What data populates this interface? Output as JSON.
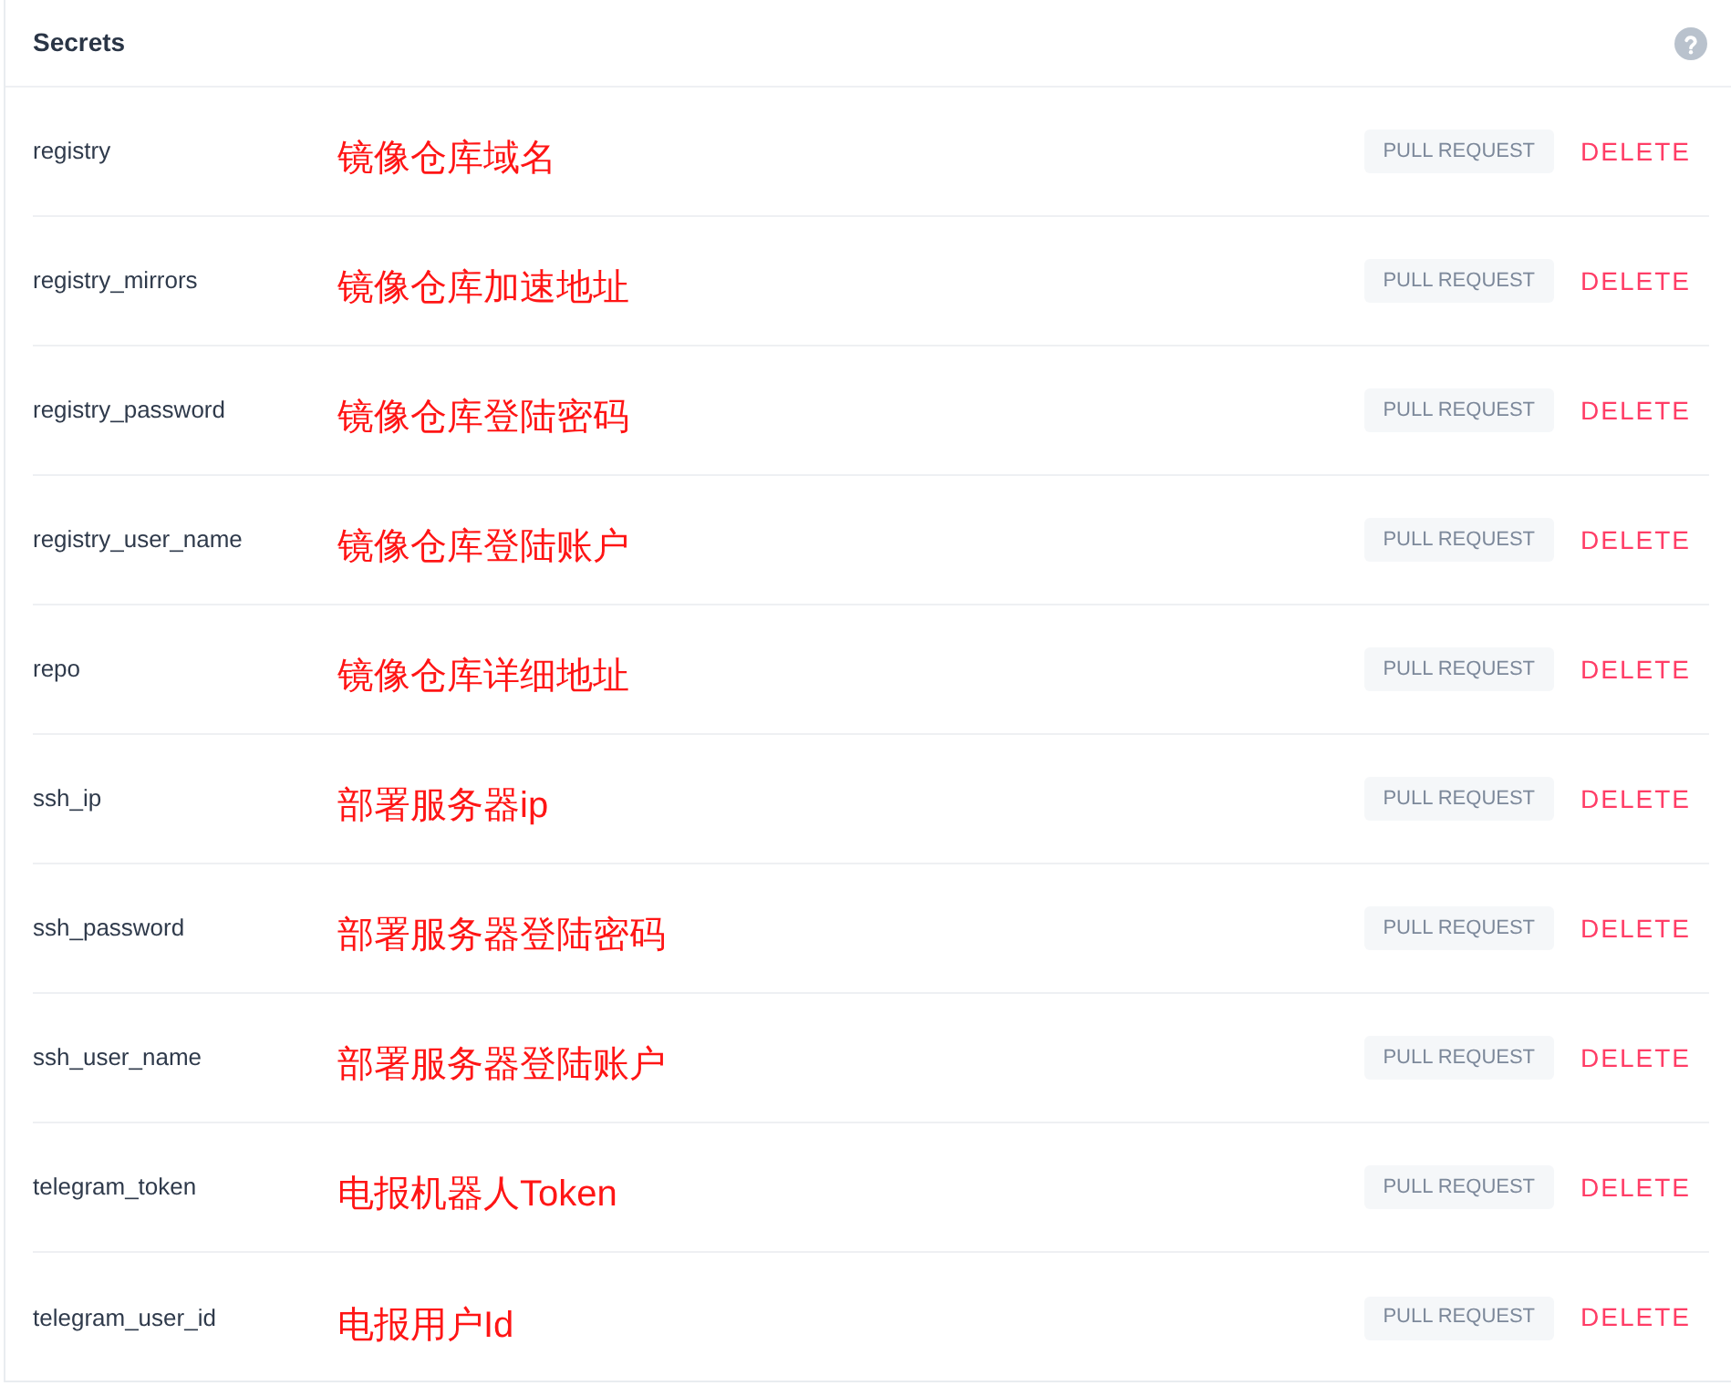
{
  "panel": {
    "title": "Secrets"
  },
  "secrets": [
    {
      "name": "registry",
      "annotation": "镜像仓库域名",
      "tag": "PULL REQUEST",
      "action": "DELETE"
    },
    {
      "name": "registry_mirrors",
      "annotation": "镜像仓库加速地址",
      "tag": "PULL REQUEST",
      "action": "DELETE"
    },
    {
      "name": "registry_password",
      "annotation": "镜像仓库登陆密码",
      "tag": "PULL REQUEST",
      "action": "DELETE"
    },
    {
      "name": "registry_user_name",
      "annotation": "镜像仓库登陆账户",
      "tag": "PULL REQUEST",
      "action": "DELETE"
    },
    {
      "name": "repo",
      "annotation": "镜像仓库详细地址",
      "tag": "PULL REQUEST",
      "action": "DELETE"
    },
    {
      "name": "ssh_ip",
      "annotation": "部署服务器ip",
      "tag": "PULL REQUEST",
      "action": "DELETE"
    },
    {
      "name": "ssh_password",
      "annotation": "部署服务器登陆密码",
      "tag": "PULL REQUEST",
      "action": "DELETE"
    },
    {
      "name": "ssh_user_name",
      "annotation": "部署服务器登陆账户",
      "tag": "PULL REQUEST",
      "action": "DELETE"
    },
    {
      "name": "telegram_token",
      "annotation": "电报机器人Token",
      "tag": "PULL REQUEST",
      "action": "DELETE"
    },
    {
      "name": "telegram_user_id",
      "annotation": "电报用户Id",
      "tag": "PULL REQUEST",
      "action": "DELETE"
    }
  ]
}
